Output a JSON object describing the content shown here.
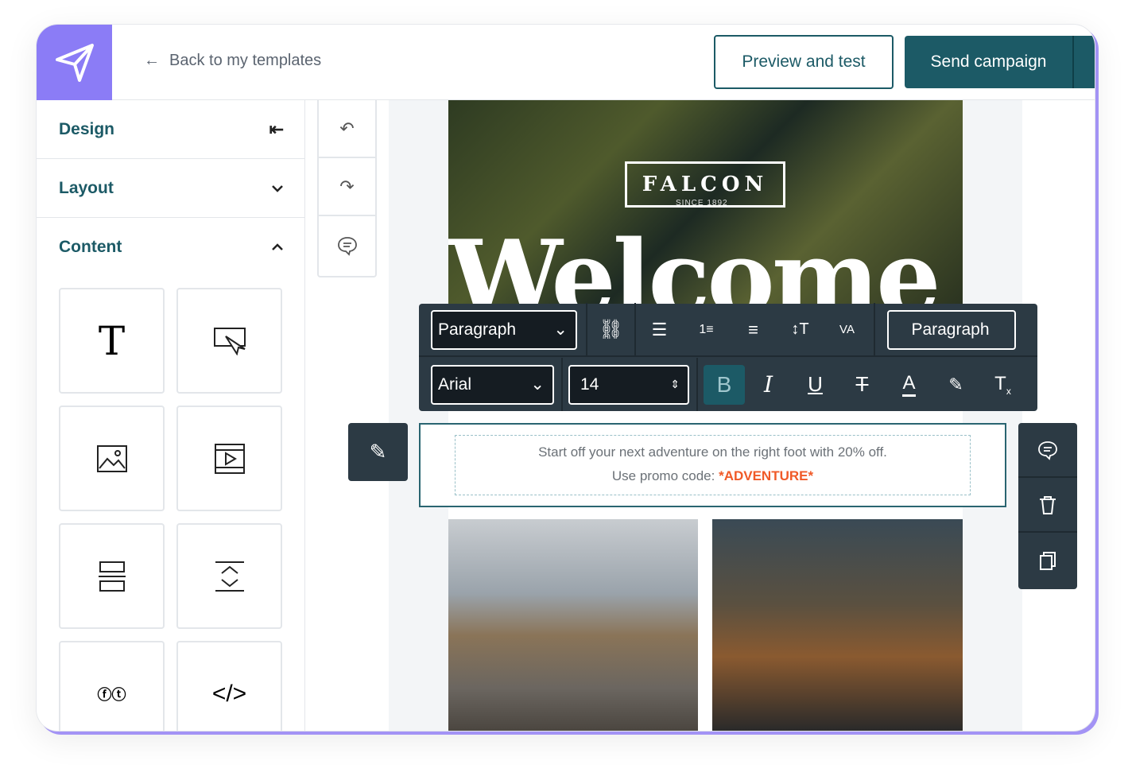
{
  "header": {
    "back_label": "Back to my templates",
    "preview_label": "Preview and test",
    "send_label": "Send campaign"
  },
  "sidebar": {
    "sections": [
      {
        "label": "Design"
      },
      {
        "label": "Layout"
      },
      {
        "label": "Content"
      }
    ],
    "tiles": [
      "text-icon",
      "button-icon",
      "image-icon",
      "video-icon",
      "divider-icon",
      "spacer-icon",
      "social-icon",
      "html-icon"
    ]
  },
  "email": {
    "brand": "FALCON",
    "since": "SINCE 1892",
    "headline": "Welcome",
    "body_line1": "Start off your next adventure on the right foot with 20% off.",
    "body_line2_prefix": "Use promo code: ",
    "promo_code": "*ADVENTURE*"
  },
  "toolbar": {
    "block_type": "Paragraph",
    "style_button": "Paragraph",
    "font": "Arial",
    "size": "14",
    "active_format": "bold"
  },
  "colors": {
    "brand_purple": "#8b7cf6",
    "primary": "#1c5a66",
    "toolbar_bg": "#2c3a44",
    "promo": "#f05a28"
  }
}
